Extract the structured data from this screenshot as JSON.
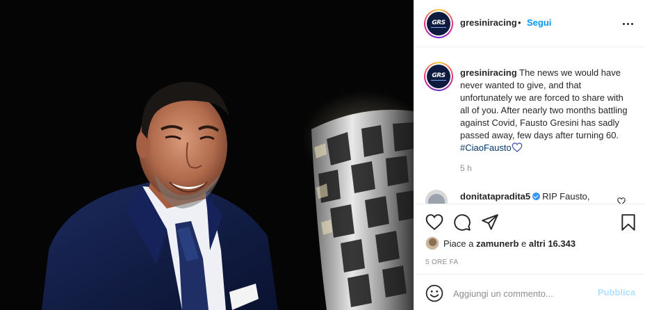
{
  "post": {
    "image_alt_subject": "",
    "icon": "photo"
  },
  "header": {
    "avatar_logo": "GRS",
    "username": "gresiniracing",
    "separator": "•",
    "follow_label": "Segui",
    "more_icon": "more-horizontal-icon"
  },
  "caption": {
    "username": "gresiniracing",
    "text": " The news we would have never wanted to give, and that unfortunately we are forced to share with all of you. After nearly two months battling against Covid, Fausto Gresini has sadly passed away, few days after turning 60. ",
    "hashtag": "#CiaoFausto",
    "heart_icon": "heart-outline-icon",
    "time": "5 h"
  },
  "comment": {
    "username": "donitatapradita5",
    "verified_icon": "verified-badge-icon",
    "text": "RIP Fausto,",
    "like_icon": "heart-outline-icon"
  },
  "actions": {
    "like_icon": "heart-outline-icon",
    "comment_icon": "comment-bubble-icon",
    "share_icon": "paper-plane-icon",
    "save_icon": "bookmark-icon"
  },
  "likes": {
    "prefix": "Piace a ",
    "user": "zamunerb",
    "middle": " e ",
    "others": "altri 16.343"
  },
  "date": "5 ORE FA",
  "add_comment": {
    "emoji_icon": "smiley-icon",
    "placeholder": "Aggiungi un commento...",
    "publish_label": "Pubblica"
  },
  "colors": {
    "link_blue": "#0095f6",
    "publish_disabled": "#b2dffc",
    "text": "#262626",
    "muted": "#8e8e8e",
    "hashtag": "#00376b"
  }
}
